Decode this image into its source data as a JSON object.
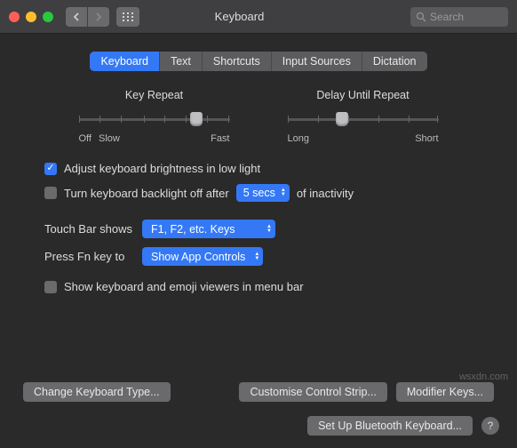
{
  "colors": {
    "accent": "#3478f6",
    "traffic_close": "#ff5f57",
    "traffic_min": "#ffbd2e",
    "traffic_max": "#28c840"
  },
  "titlebar": {
    "title": "Keyboard",
    "search_placeholder": "Search"
  },
  "tabs": [
    {
      "label": "Keyboard",
      "active": true
    },
    {
      "label": "Text",
      "active": false
    },
    {
      "label": "Shortcuts",
      "active": false
    },
    {
      "label": "Input Sources",
      "active": false
    },
    {
      "label": "Dictation",
      "active": false
    }
  ],
  "sliders": {
    "key_repeat": {
      "title": "Key Repeat",
      "left1": "Off",
      "left2": "Slow",
      "right": "Fast",
      "value_pct": 78,
      "ticks": 8
    },
    "delay_repeat": {
      "title": "Delay Until Repeat",
      "left": "Long",
      "right": "Short",
      "value_pct": 36,
      "ticks": 6
    }
  },
  "checks": {
    "brightness_low_light": {
      "label": "Adjust keyboard brightness in low light",
      "checked": true
    },
    "backlight_off": {
      "label_pre": "Turn keyboard backlight off after",
      "value": "5 secs",
      "label_post": "of inactivity",
      "checked": false
    },
    "show_viewers": {
      "label": "Show keyboard and emoji viewers in menu bar",
      "checked": false
    }
  },
  "form": {
    "touch_bar": {
      "label": "Touch Bar shows",
      "value": "F1, F2, etc. Keys"
    },
    "press_fn": {
      "label": "Press Fn key to",
      "value": "Show App Controls"
    }
  },
  "buttons": {
    "change_type": "Change Keyboard Type...",
    "customise_strip": "Customise Control Strip...",
    "modifier_keys": "Modifier Keys...",
    "bluetooth": "Set Up Bluetooth Keyboard...",
    "help": "?"
  },
  "watermark": "wsxdn.com"
}
